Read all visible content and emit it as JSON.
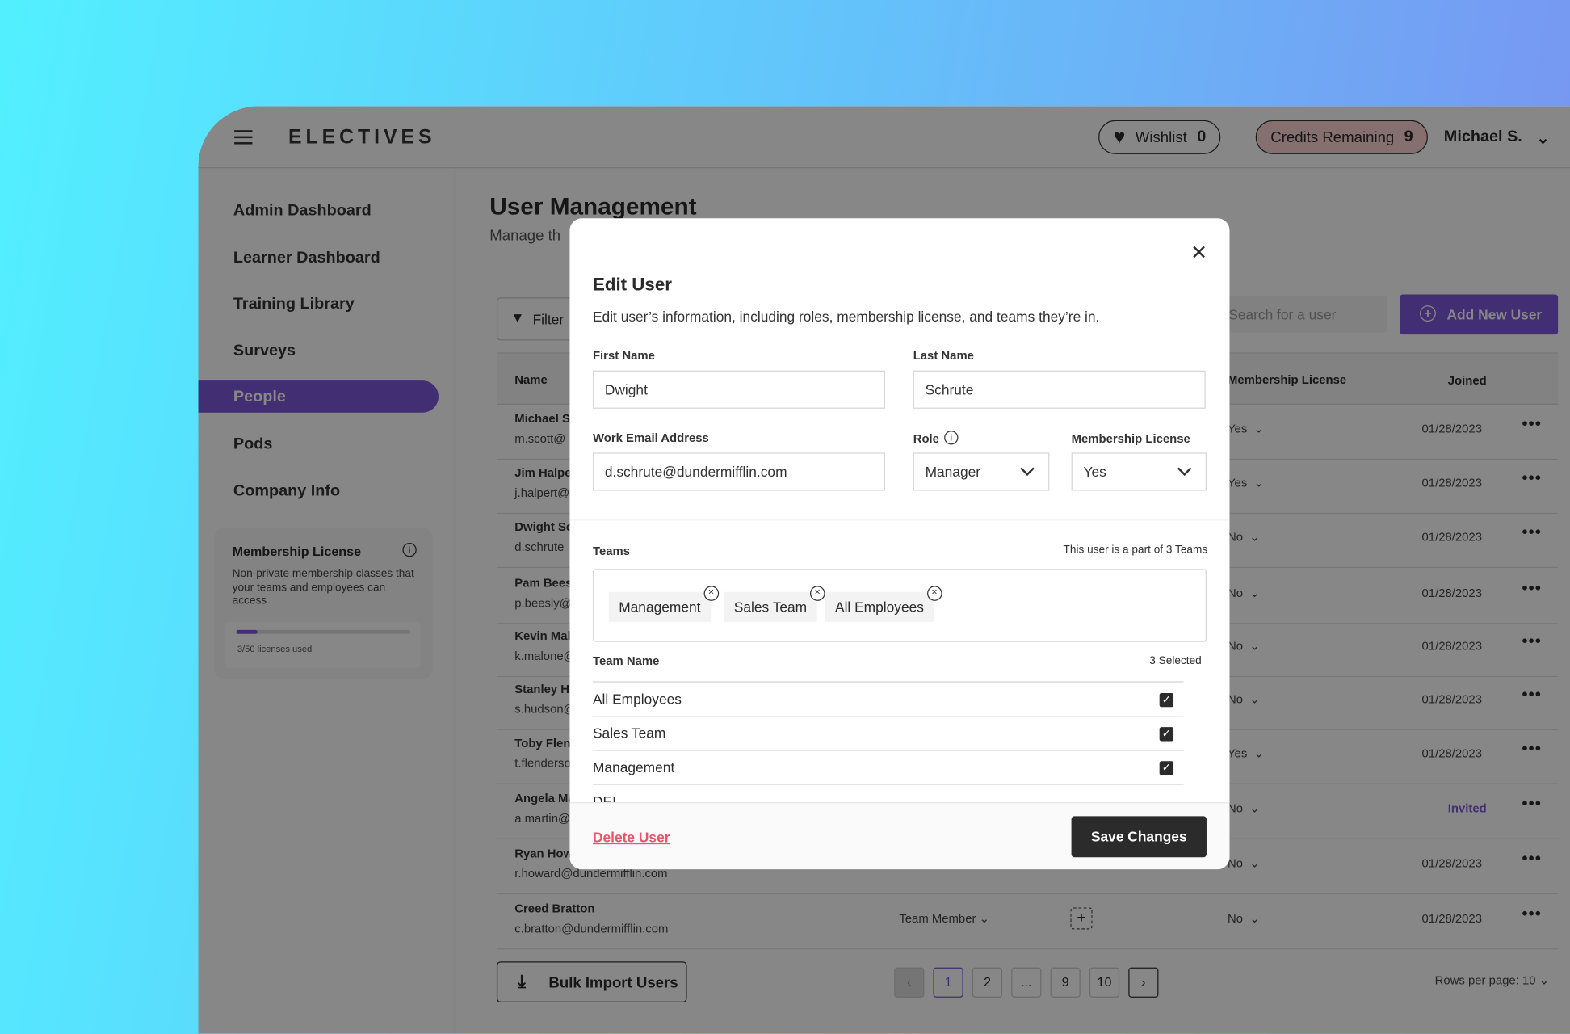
{
  "colors": {
    "accent": "#7d58d8",
    "danger": "#e8566b",
    "dark_button": "#2b2b2b"
  },
  "header": {
    "logo": "ELECTIVES",
    "wishlist_label": "Wishlist",
    "wishlist_count": "0",
    "credits_label": "Credits Remaining",
    "credits_count": "9",
    "user_name": "Michael S."
  },
  "sidebar": {
    "items": [
      {
        "label": "Admin Dashboard"
      },
      {
        "label": "Learner Dashboard"
      },
      {
        "label": "Training Library"
      },
      {
        "label": "Surveys"
      },
      {
        "label": "People",
        "active": true
      },
      {
        "label": "Pods"
      },
      {
        "label": "Company Info"
      }
    ],
    "license_card": {
      "title": "Membership License",
      "description": "Non-private membership classes that your teams and employees can access",
      "used": 3,
      "total": 50,
      "usage_text": "3/50 licenses used"
    }
  },
  "main": {
    "title": "User Management",
    "subtitle": "Manage th",
    "filter_label": "Filter",
    "search_placeholder": "Search for a user",
    "add_user_label": "Add New User",
    "columns": {
      "name": "Name",
      "license": "Membership License",
      "joined": "Joined"
    },
    "rows": [
      {
        "name": "Michael Sc",
        "email": "m.scott@",
        "license": "Yes",
        "joined": "01/28/2023"
      },
      {
        "name": "Jim Halpe",
        "email": "j.halpert@",
        "license": "Yes",
        "joined": "01/28/2023"
      },
      {
        "name": "Dwight Sc",
        "email": "d.schrute",
        "license": "No",
        "joined": "01/28/2023"
      },
      {
        "name": "Pam Bees",
        "email": "p.beesly@",
        "license": "No",
        "joined": "01/28/2023"
      },
      {
        "name": "Kevin Mal",
        "email": "k.malone@",
        "license": "No",
        "joined": "01/28/2023"
      },
      {
        "name": "Stanley H",
        "email": "s.hudson@",
        "license": "No",
        "joined": "01/28/2023"
      },
      {
        "name": "Toby Flen",
        "email": "t.flenderso",
        "license": "Yes",
        "joined": "01/28/2023"
      },
      {
        "name": "Angela Ma",
        "email": "a.martin@",
        "license": "No",
        "joined": "Invited"
      },
      {
        "name": "Ryan How",
        "email": "r.howard@dundermifflin.com",
        "license": "No",
        "joined": "01/28/2023"
      },
      {
        "name": "Creed Bratton",
        "email": "c.bratton@dundermifflin.com",
        "role": "Team Member",
        "license": "No",
        "joined": "01/28/2023"
      }
    ],
    "bulk_import_label": "Bulk Import Users",
    "pagination": {
      "pages": [
        "1",
        "2",
        "...",
        "9",
        "10"
      ],
      "current": "1"
    },
    "rows_per_page": "Rows per page: 10"
  },
  "modal": {
    "title": "Edit User",
    "description": "Edit user’s information, including roles, membership license, and teams they’re in.",
    "first_name_label": "First Name",
    "first_name": "Dwight",
    "last_name_label": "Last Name",
    "last_name": "Schrute",
    "email_label": "Work Email Address",
    "email": "d.schrute@dundermifflin.com",
    "role_label": "Role",
    "role": "Manager",
    "license_label": "Membership License",
    "license": "Yes",
    "teams_label": "Teams",
    "teams_count_text": "This user is a part of 3 Teams",
    "tags": [
      "Management",
      "Sales Team",
      "All Employees"
    ],
    "team_name_header": "Team Name",
    "selected_text": "3 Selected",
    "team_rows": [
      {
        "name": "All Employees",
        "checked": true
      },
      {
        "name": "Sales Team",
        "checked": true
      },
      {
        "name": "Management",
        "checked": true
      },
      {
        "name": "DEI",
        "checked": false
      }
    ],
    "delete_label": "Delete User",
    "save_label": "Save Changes"
  }
}
